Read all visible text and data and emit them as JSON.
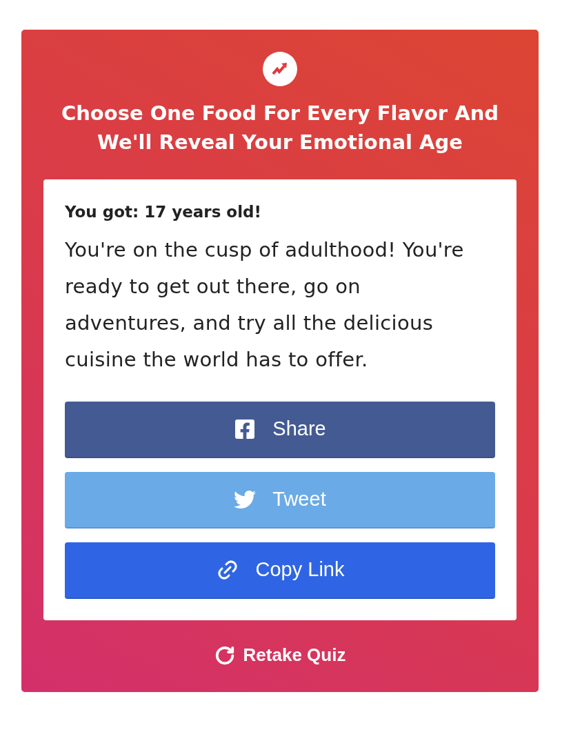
{
  "header": {
    "title": "Choose One Food For Every Flavor And We'll Reveal Your Emotional Age"
  },
  "result": {
    "heading": "You got: 17 years old!",
    "description": "You're on the cusp of adulthood! You're ready to get out there, go on adventures, and try all the delicious cuisine the world has to offer."
  },
  "share_buttons": [
    {
      "kind": "facebook",
      "label": "Share"
    },
    {
      "kind": "twitter",
      "label": "Tweet"
    },
    {
      "kind": "link",
      "label": "Copy Link"
    }
  ],
  "retake": {
    "label": "Retake Quiz"
  }
}
